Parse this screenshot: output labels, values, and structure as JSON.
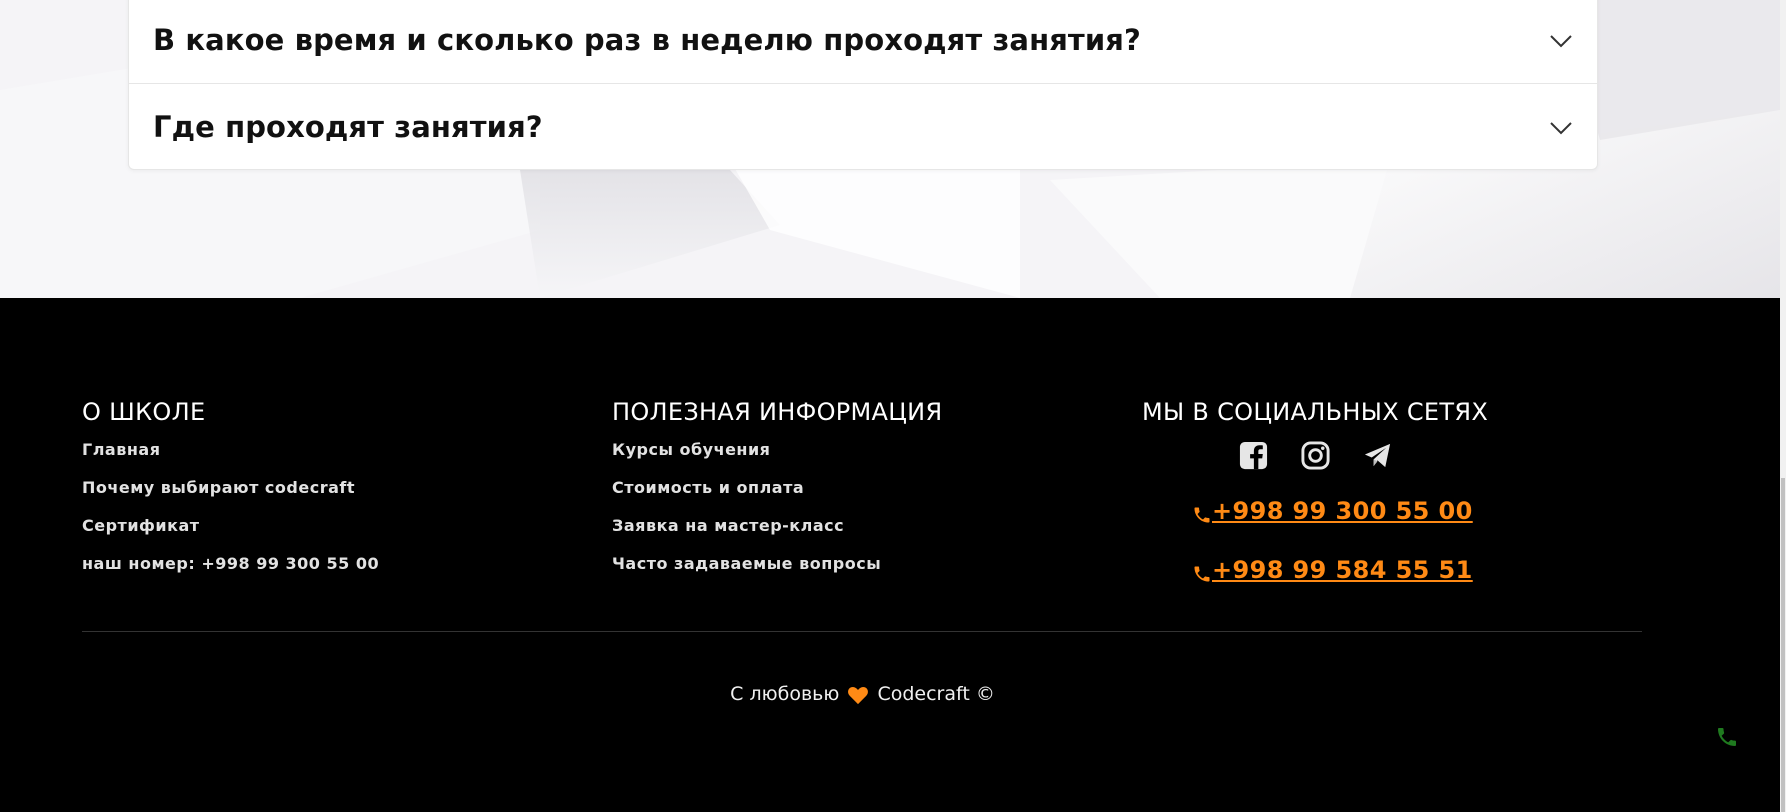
{
  "faq": {
    "items": [
      {
        "question": "В какое время и сколько раз в неделю проходят занятия?"
      },
      {
        "question": "Где проходят занятия?"
      }
    ]
  },
  "footer": {
    "about": {
      "title": "О ШКОЛЕ",
      "links": [
        "Главная",
        "Почему выбирают codecraft",
        "Сертификат",
        "наш номер: +998 99 300 55 00"
      ]
    },
    "info": {
      "title": "ПОЛЕЗНАЯ ИНФОРМАЦИЯ",
      "links": [
        "Курсы обучения",
        "Стоимость и оплата",
        "Заявка на мастер-класс",
        "Часто задаваемые вопросы"
      ]
    },
    "social": {
      "title": "МЫ В СОЦИАЛЬНЫХ СЕТЯХ",
      "icons": [
        "facebook-icon",
        "instagram-icon",
        "telegram-icon"
      ],
      "phones": [
        "+998 99 300 55 00",
        "+998 99 584 55 51"
      ]
    },
    "copyright": {
      "before": "С любовью",
      "after": "Codecraft ©"
    }
  },
  "colors": {
    "accent": "#ff8a15",
    "footer_bg": "#000000",
    "call_button": "#1f7a1f"
  }
}
